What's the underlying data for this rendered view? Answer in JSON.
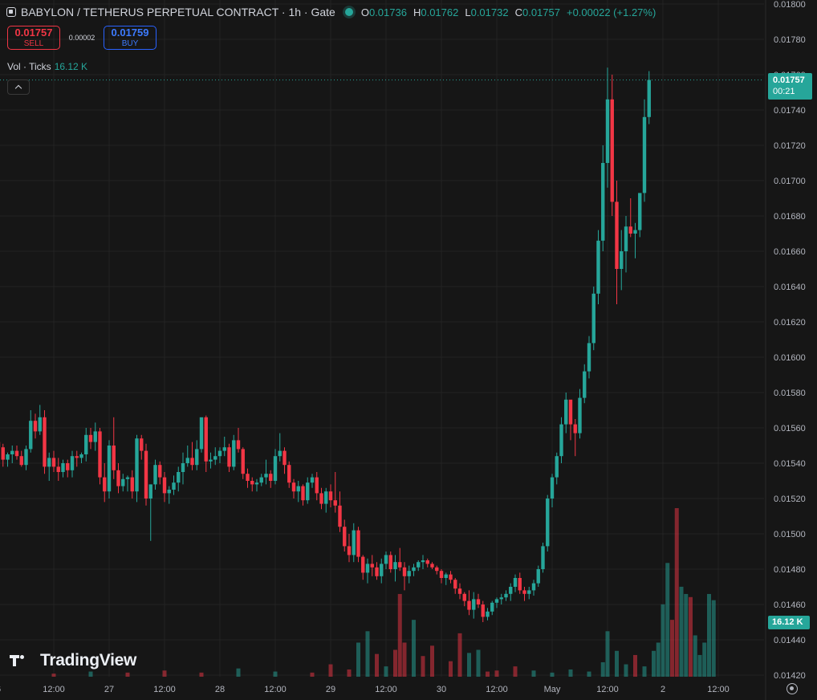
{
  "header": {
    "symbol": "BABYLON / TETHERUS PERPETUAL CONTRACT · 1h · Gate",
    "open_label": "O",
    "open": "0.01736",
    "high_label": "H",
    "high": "0.01762",
    "low_label": "L",
    "low": "0.01732",
    "close_label": "C",
    "close": "0.01757",
    "change": "+0.00022 (+1.27%)"
  },
  "trade": {
    "sell_price": "0.01757",
    "sell_label": "SELL",
    "spread": "0.00002",
    "buy_price": "0.01759",
    "buy_label": "BUY"
  },
  "volume_legend": {
    "label": "Vol · Ticks",
    "value": "16.12 K"
  },
  "price_tag": {
    "price": "0.01757",
    "countdown": "00:21"
  },
  "volume_tag": "16.12 K",
  "branding": "TradingView",
  "colors": {
    "up": "#26a69a",
    "down": "#f23645",
    "background": "#161616",
    "grid": "#232323"
  },
  "chart_data": {
    "type": "candlestick",
    "y_axis_ticks": [
      "0.01800",
      "0.01780",
      "0.01760",
      "0.01740",
      "0.01720",
      "0.01700",
      "0.01680",
      "0.01660",
      "0.01640",
      "0.01620",
      "0.01600",
      "0.01580",
      "0.01560",
      "0.01540",
      "0.01520",
      "0.01500",
      "0.01480",
      "0.01460",
      "0.01440",
      "0.01420"
    ],
    "x_axis_ticks": [
      {
        "label": "6",
        "t": -12
      },
      {
        "label": "12:00",
        "t": 0
      },
      {
        "label": "27",
        "t": 12
      },
      {
        "label": "12:00",
        "t": 24
      },
      {
        "label": "28",
        "t": 36
      },
      {
        "label": "12:00",
        "t": 48
      },
      {
        "label": "29",
        "t": 60
      },
      {
        "label": "12:00",
        "t": 72
      },
      {
        "label": "30",
        "t": 84
      },
      {
        "label": "12:00",
        "t": 96
      },
      {
        "label": "May",
        "t": 108
      },
      {
        "label": "12:00",
        "t": 120
      },
      {
        "label": "2",
        "t": 132
      },
      {
        "label": "12:00",
        "t": 144
      }
    ],
    "ylim": [
      0.0142,
      0.018
    ],
    "last_price": 0.01757,
    "candles_ohlc": [
      [
        0.01556,
        0.01557,
        0.01532,
        0.01552
      ],
      [
        0.01552,
        0.01554,
        0.01545,
        0.01549
      ],
      [
        0.01549,
        0.01551,
        0.01538,
        0.01542
      ],
      [
        0.01542,
        0.01546,
        0.01538,
        0.01545
      ],
      [
        0.01545,
        0.0155,
        0.0154,
        0.01547
      ],
      [
        0.01547,
        0.0155,
        0.01542,
        0.01544
      ],
      [
        0.01544,
        0.01547,
        0.01538,
        0.01539
      ],
      [
        0.01539,
        0.0155,
        0.01536,
        0.01548
      ],
      [
        0.01548,
        0.0157,
        0.01546,
        0.01564
      ],
      [
        0.01564,
        0.01568,
        0.01554,
        0.01558
      ],
      [
        0.01558,
        0.01573,
        0.01556,
        0.01566
      ],
      [
        0.01566,
        0.0157,
        0.01534,
        0.01538
      ],
      [
        0.01538,
        0.01546,
        0.0153,
        0.01543
      ],
      [
        0.01543,
        0.01547,
        0.01535,
        0.01538
      ],
      [
        0.01538,
        0.01543,
        0.0153,
        0.01535
      ],
      [
        0.01535,
        0.01542,
        0.01532,
        0.0154
      ],
      [
        0.0154,
        0.01542,
        0.01532,
        0.01536
      ],
      [
        0.01536,
        0.01547,
        0.01532,
        0.01544
      ],
      [
        0.01544,
        0.01547,
        0.01538,
        0.01543
      ],
      [
        0.01543,
        0.01546,
        0.0154,
        0.01545
      ],
      [
        0.01545,
        0.0156,
        0.01541,
        0.01556
      ],
      [
        0.01556,
        0.0156,
        0.01548,
        0.01552
      ],
      [
        0.01552,
        0.01563,
        0.01547,
        0.01558
      ],
      [
        0.01558,
        0.0156,
        0.01528,
        0.01532
      ],
      [
        0.01532,
        0.0154,
        0.01518,
        0.01524
      ],
      [
        0.01524,
        0.01553,
        0.0152,
        0.0155
      ],
      [
        0.0155,
        0.01566,
        0.01531,
        0.01536
      ],
      [
        0.01536,
        0.0154,
        0.01523,
        0.01527
      ],
      [
        0.01527,
        0.01534,
        0.01524,
        0.01531
      ],
      [
        0.01531,
        0.01533,
        0.01524,
        0.01532
      ],
      [
        0.01532,
        0.01536,
        0.0152,
        0.01524
      ],
      [
        0.01524,
        0.01556,
        0.01518,
        0.01554
      ],
      [
        0.01554,
        0.01556,
        0.01542,
        0.01547
      ],
      [
        0.01547,
        0.01551,
        0.01516,
        0.0152
      ],
      [
        0.0152,
        0.01528,
        0.01496,
        0.01528
      ],
      [
        0.01528,
        0.01542,
        0.01525,
        0.01539
      ],
      [
        0.01539,
        0.01541,
        0.01528,
        0.01532
      ],
      [
        0.01532,
        0.01535,
        0.01518,
        0.01523
      ],
      [
        0.01523,
        0.01527,
        0.01517,
        0.01525
      ],
      [
        0.01525,
        0.01533,
        0.01522,
        0.01529
      ],
      [
        0.01529,
        0.01538,
        0.01524,
        0.01535
      ],
      [
        0.01535,
        0.01546,
        0.01528,
        0.0154
      ],
      [
        0.0154,
        0.0155,
        0.01538,
        0.01543
      ],
      [
        0.01543,
        0.01552,
        0.01536,
        0.01539
      ],
      [
        0.01539,
        0.01553,
        0.01536,
        0.01548
      ],
      [
        0.01548,
        0.0156,
        0.01546,
        0.01566
      ],
      [
        0.01566,
        0.01567,
        0.01535,
        0.01541
      ],
      [
        0.01541,
        0.01546,
        0.01537,
        0.01542
      ],
      [
        0.01542,
        0.01549,
        0.01539,
        0.01544
      ],
      [
        0.01544,
        0.01549,
        0.0154,
        0.01547
      ],
      [
        0.01547,
        0.01555,
        0.01544,
        0.01549
      ],
      [
        0.01549,
        0.01551,
        0.01535,
        0.01538
      ],
      [
        0.01538,
        0.01556,
        0.01536,
        0.01553
      ],
      [
        0.01553,
        0.0156,
        0.01546,
        0.01548
      ],
      [
        0.01548,
        0.01549,
        0.01531,
        0.01534
      ],
      [
        0.01534,
        0.01537,
        0.01526,
        0.0153
      ],
      [
        0.0153,
        0.01532,
        0.01524,
        0.01528
      ],
      [
        0.01528,
        0.01531,
        0.01524,
        0.01529
      ],
      [
        0.01529,
        0.01534,
        0.01527,
        0.01532
      ],
      [
        0.01532,
        0.01542,
        0.01528,
        0.01534
      ],
      [
        0.01534,
        0.01536,
        0.01526,
        0.0153
      ],
      [
        0.0153,
        0.01548,
        0.01528,
        0.01544
      ],
      [
        0.01544,
        0.01557,
        0.01541,
        0.01547
      ],
      [
        0.01547,
        0.01549,
        0.01534,
        0.01539
      ],
      [
        0.01539,
        0.01541,
        0.01526,
        0.01529
      ],
      [
        0.01529,
        0.01531,
        0.0152,
        0.01524
      ],
      [
        0.01524,
        0.0153,
        0.01518,
        0.01527
      ],
      [
        0.01527,
        0.01528,
        0.01516,
        0.01519
      ],
      [
        0.01519,
        0.01532,
        0.01517,
        0.01529
      ],
      [
        0.01529,
        0.01534,
        0.01526,
        0.01532
      ],
      [
        0.01532,
        0.01535,
        0.01519,
        0.01523
      ],
      [
        0.01523,
        0.01526,
        0.01514,
        0.01517
      ],
      [
        0.01517,
        0.01526,
        0.01512,
        0.01524
      ],
      [
        0.01524,
        0.01528,
        0.01515,
        0.01519
      ],
      [
        0.01519,
        0.01535,
        0.01512,
        0.01516
      ],
      [
        0.01516,
        0.01524,
        0.01501,
        0.01504
      ],
      [
        0.01504,
        0.01508,
        0.0149,
        0.01493
      ],
      [
        0.01493,
        0.015,
        0.01484,
        0.01488
      ],
      [
        0.01488,
        0.01506,
        0.01484,
        0.01502
      ],
      [
        0.01502,
        0.01504,
        0.01484,
        0.01487
      ],
      [
        0.01487,
        0.01488,
        0.01474,
        0.01478
      ],
      [
        0.01478,
        0.01486,
        0.01472,
        0.01483
      ],
      [
        0.01483,
        0.01488,
        0.01476,
        0.01481
      ],
      [
        0.01481,
        0.01484,
        0.01474,
        0.01476
      ],
      [
        0.01476,
        0.01486,
        0.01472,
        0.01483
      ],
      [
        0.01483,
        0.0149,
        0.0148,
        0.01488
      ],
      [
        0.01488,
        0.0149,
        0.01478,
        0.0148
      ],
      [
        0.0148,
        0.01488,
        0.01473,
        0.01484
      ],
      [
        0.01484,
        0.01492,
        0.01479,
        0.01481
      ],
      [
        0.01481,
        0.01484,
        0.01468,
        0.01476
      ],
      [
        0.01476,
        0.01482,
        0.01472,
        0.01479
      ],
      [
        0.01479,
        0.01483,
        0.01476,
        0.01481
      ],
      [
        0.01481,
        0.01485,
        0.01479,
        0.01484
      ],
      [
        0.01484,
        0.01488,
        0.0148,
        0.01485
      ],
      [
        0.01485,
        0.01486,
        0.01481,
        0.01483
      ],
      [
        0.01483,
        0.01484,
        0.0148,
        0.01481
      ],
      [
        0.01481,
        0.01482,
        0.01477,
        0.01479
      ],
      [
        0.01479,
        0.0148,
        0.01472,
        0.01475
      ],
      [
        0.01475,
        0.01478,
        0.01471,
        0.01477
      ],
      [
        0.01477,
        0.01479,
        0.01472,
        0.01474
      ],
      [
        0.01474,
        0.01475,
        0.01466,
        0.01469
      ],
      [
        0.01469,
        0.01472,
        0.01463,
        0.01466
      ],
      [
        0.01466,
        0.01467,
        0.01459,
        0.01462
      ],
      [
        0.01462,
        0.01468,
        0.01454,
        0.01457
      ],
      [
        0.01457,
        0.01467,
        0.01452,
        0.01463
      ],
      [
        0.01463,
        0.01466,
        0.01458,
        0.0146
      ],
      [
        0.0146,
        0.01462,
        0.0145,
        0.01453
      ],
      [
        0.01453,
        0.01458,
        0.01451,
        0.01456
      ],
      [
        0.01456,
        0.01462,
        0.01454,
        0.01461
      ],
      [
        0.01461,
        0.01464,
        0.01458,
        0.01463
      ],
      [
        0.01463,
        0.01466,
        0.0146,
        0.01464
      ],
      [
        0.01464,
        0.01468,
        0.01462,
        0.01466
      ],
      [
        0.01466,
        0.01472,
        0.01462,
        0.0147
      ],
      [
        0.0147,
        0.01477,
        0.01467,
        0.01475
      ],
      [
        0.01475,
        0.01478,
        0.01466,
        0.01468
      ],
      [
        0.01468,
        0.0147,
        0.01462,
        0.01466
      ],
      [
        0.01466,
        0.0147,
        0.01463,
        0.01468
      ],
      [
        0.01468,
        0.01474,
        0.01465,
        0.01472
      ],
      [
        0.01472,
        0.01482,
        0.0147,
        0.0148
      ],
      [
        0.0148,
        0.01495,
        0.01478,
        0.01493
      ],
      [
        0.01493,
        0.01522,
        0.0149,
        0.0152
      ],
      [
        0.0152,
        0.01534,
        0.01515,
        0.01532
      ],
      [
        0.01532,
        0.01546,
        0.01528,
        0.01544
      ],
      [
        0.01544,
        0.01566,
        0.0154,
        0.01562
      ],
      [
        0.01562,
        0.0158,
        0.01557,
        0.01576
      ],
      [
        0.01576,
        0.01573,
        0.01553,
        0.01562
      ],
      [
        0.01562,
        0.01565,
        0.01544,
        0.01557
      ],
      [
        0.01557,
        0.01582,
        0.01554,
        0.01577
      ],
      [
        0.01577,
        0.01596,
        0.01574,
        0.01592
      ],
      [
        0.01592,
        0.01612,
        0.01588,
        0.01608
      ],
      [
        0.01608,
        0.0164,
        0.01604,
        0.01636
      ],
      [
        0.01636,
        0.01672,
        0.0163,
        0.01666
      ],
      [
        0.01666,
        0.0172,
        0.0166,
        0.0171
      ],
      [
        0.0171,
        0.01764,
        0.01696,
        0.01746
      ],
      [
        0.01746,
        0.0176,
        0.0168,
        0.01688
      ],
      [
        0.01688,
        0.017,
        0.0163,
        0.0165
      ],
      [
        0.0165,
        0.01672,
        0.01638,
        0.0166
      ],
      [
        0.0166,
        0.0168,
        0.01648,
        0.01674
      ],
      [
        0.01674,
        0.0169,
        0.01668,
        0.0167
      ],
      [
        0.0167,
        0.01676,
        0.01656,
        0.01672
      ],
      [
        0.01672,
        0.0169,
        0.01668,
        0.01693
      ],
      [
        0.01693,
        0.01746,
        0.01688,
        0.01736
      ],
      [
        0.01736,
        0.01762,
        0.01732,
        0.01757
      ]
    ],
    "volume": [
      {
        "t": 0,
        "v": 0.3
      },
      {
        "t": 8,
        "v": 0.5
      },
      {
        "t": 16,
        "v": 0.4
      },
      {
        "t": 24,
        "v": 0.6
      },
      {
        "t": 32,
        "v": 0.4
      },
      {
        "t": 40,
        "v": 0.8
      },
      {
        "t": 48,
        "v": 0.5
      },
      {
        "t": 56,
        "v": 0.4
      },
      {
        "t": 60,
        "v": 1.2
      },
      {
        "t": 64,
        "v": 0.7
      },
      {
        "t": 66,
        "v": 3.3
      },
      {
        "t": 68,
        "v": 4.4
      },
      {
        "t": 70,
        "v": 2.2
      },
      {
        "t": 72,
        "v": 1.0
      },
      {
        "t": 74,
        "v": 2.6
      },
      {
        "t": 75,
        "v": 8.0
      },
      {
        "t": 76,
        "v": 3.3
      },
      {
        "t": 78,
        "v": 5.5
      },
      {
        "t": 80,
        "v": 2.0
      },
      {
        "t": 82,
        "v": 3.0
      },
      {
        "t": 86,
        "v": 1.5
      },
      {
        "t": 88,
        "v": 4.2
      },
      {
        "t": 90,
        "v": 2.3
      },
      {
        "t": 92,
        "v": 2.6
      },
      {
        "t": 94,
        "v": 0.5
      },
      {
        "t": 96,
        "v": 0.6
      },
      {
        "t": 100,
        "v": 1.0
      },
      {
        "t": 104,
        "v": 0.6
      },
      {
        "t": 108,
        "v": 0.4
      },
      {
        "t": 112,
        "v": 0.7
      },
      {
        "t": 116,
        "v": 0.5
      },
      {
        "t": 119,
        "v": 1.4
      },
      {
        "t": 120,
        "v": 4.4
      },
      {
        "t": 122,
        "v": 2.5
      },
      {
        "t": 124,
        "v": 1.2
      },
      {
        "t": 126,
        "v": 2.1
      },
      {
        "t": 128,
        "v": 1.0
      },
      {
        "t": 130,
        "v": 2.5
      },
      {
        "t": 131,
        "v": 3.3
      },
      {
        "t": 132,
        "v": 7.0
      },
      {
        "t": 133,
        "v": 11.0
      },
      {
        "t": 134,
        "v": 5.5
      },
      {
        "t": 135,
        "v": 16.3
      },
      {
        "t": 136,
        "v": 8.7
      },
      {
        "t": 137,
        "v": 8.0
      },
      {
        "t": 138,
        "v": 7.7
      },
      {
        "t": 139,
        "v": 4.0
      },
      {
        "t": 140,
        "v": 2.1
      },
      {
        "t": 141,
        "v": 3.3
      },
      {
        "t": 142,
        "v": 8.0
      },
      {
        "t": 143,
        "v": 7.4
      }
    ]
  }
}
